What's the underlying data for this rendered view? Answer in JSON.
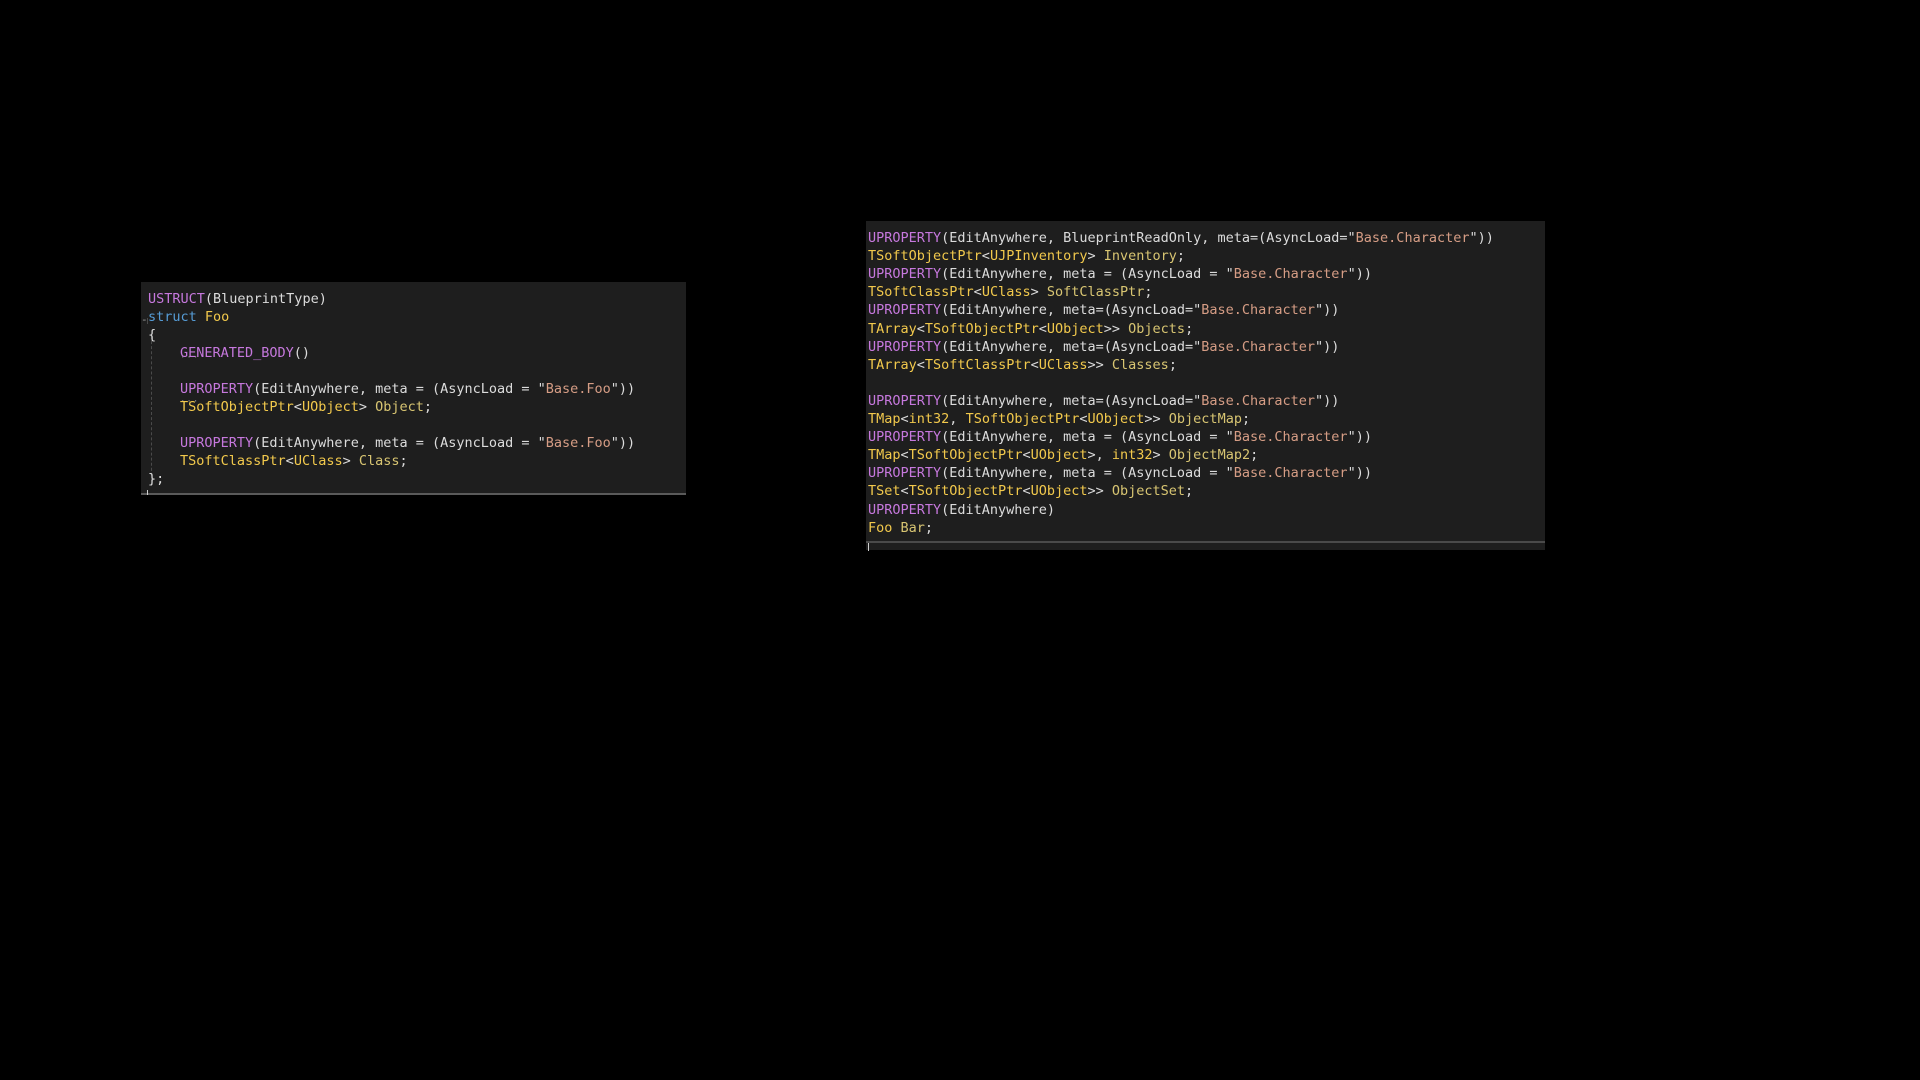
{
  "colors": {
    "background": "#000000",
    "editor_bg": "#1e1e1e",
    "plain": "#dcdcdc",
    "macro": "#c678dd",
    "keyword": "#569cd6",
    "type": "#f2c94c",
    "ident": "#d8c572",
    "string": "#d69d85"
  },
  "left_editor": {
    "lines": [
      [
        [
          "USTRUCT",
          "macro"
        ],
        [
          "(BlueprintType)",
          "plain"
        ]
      ],
      [
        [
          "struct",
          "keyword"
        ],
        [
          " ",
          "plain"
        ],
        [
          "Foo",
          "type"
        ]
      ],
      [
        [
          "{",
          "plain"
        ]
      ],
      [
        [
          "",
          "indent"
        ],
        [
          "GENERATED_BODY",
          "macro"
        ],
        [
          "()",
          "plain"
        ]
      ],
      [],
      [
        [
          "",
          "indent"
        ],
        [
          "UPROPERTY",
          "macro"
        ],
        [
          "(EditAnywhere, meta = (AsyncLoad = \"",
          "plain"
        ],
        [
          "Base.Foo",
          "string"
        ],
        [
          "\"))",
          "plain"
        ]
      ],
      [
        [
          "",
          "indent"
        ],
        [
          "TSoftObjectPtr",
          "type"
        ],
        [
          "<",
          "plain"
        ],
        [
          "UObject",
          "type"
        ],
        [
          "> ",
          "plain"
        ],
        [
          "Object",
          "ident"
        ],
        [
          ";",
          "plain"
        ]
      ],
      [],
      [
        [
          "",
          "indent"
        ],
        [
          "UPROPERTY",
          "macro"
        ],
        [
          "(EditAnywhere, meta = (AsyncLoad = \"",
          "plain"
        ],
        [
          "Base.Foo",
          "string"
        ],
        [
          "\"))",
          "plain"
        ]
      ],
      [
        [
          "",
          "indent"
        ],
        [
          "TSoftClassPtr",
          "type"
        ],
        [
          "<",
          "plain"
        ],
        [
          "UClass",
          "type"
        ],
        [
          "> ",
          "plain"
        ],
        [
          "Class",
          "ident"
        ],
        [
          ";",
          "plain"
        ]
      ],
      [
        [
          "};",
          "plain"
        ]
      ]
    ]
  },
  "right_editor": {
    "lines": [
      [
        [
          "UPROPERTY",
          "macro"
        ],
        [
          "(EditAnywhere, BlueprintReadOnly, meta=(AsyncLoad=\"",
          "plain"
        ],
        [
          "Base.Character",
          "string"
        ],
        [
          "\"))",
          "plain"
        ]
      ],
      [
        [
          "TSoftObjectPtr",
          "type"
        ],
        [
          "<",
          "plain"
        ],
        [
          "UJPInventory",
          "type"
        ],
        [
          "> ",
          "plain"
        ],
        [
          "Inventory",
          "ident"
        ],
        [
          ";",
          "plain"
        ]
      ],
      [
        [
          "UPROPERTY",
          "macro"
        ],
        [
          "(EditAnywhere, meta = (AsyncLoad = \"",
          "plain"
        ],
        [
          "Base.Character",
          "string"
        ],
        [
          "\"))",
          "plain"
        ]
      ],
      [
        [
          "TSoftClassPtr",
          "type"
        ],
        [
          "<",
          "plain"
        ],
        [
          "UClass",
          "type"
        ],
        [
          "> ",
          "plain"
        ],
        [
          "SoftClassPtr",
          "ident"
        ],
        [
          ";",
          "plain"
        ]
      ],
      [
        [
          "UPROPERTY",
          "macro"
        ],
        [
          "(EditAnywhere, meta=(AsyncLoad=\"",
          "plain"
        ],
        [
          "Base.Character",
          "string"
        ],
        [
          "\"))",
          "plain"
        ]
      ],
      [
        [
          "TArray",
          "type"
        ],
        [
          "<",
          "plain"
        ],
        [
          "TSoftObjectPtr",
          "type"
        ],
        [
          "<",
          "plain"
        ],
        [
          "UObject",
          "type"
        ],
        [
          ">> ",
          "plain"
        ],
        [
          "Objects",
          "ident"
        ],
        [
          ";",
          "plain"
        ]
      ],
      [
        [
          "UPROPERTY",
          "macro"
        ],
        [
          "(EditAnywhere, meta=(AsyncLoad=\"",
          "plain"
        ],
        [
          "Base.Character",
          "string"
        ],
        [
          "\"))",
          "plain"
        ]
      ],
      [
        [
          "TArray",
          "type"
        ],
        [
          "<",
          "plain"
        ],
        [
          "TSoftClassPtr",
          "type"
        ],
        [
          "<",
          "plain"
        ],
        [
          "UClass",
          "type"
        ],
        [
          ">> ",
          "plain"
        ],
        [
          "Classes",
          "ident"
        ],
        [
          ";",
          "plain"
        ]
      ],
      [],
      [
        [
          "UPROPERTY",
          "macro"
        ],
        [
          "(EditAnywhere, meta=(AsyncLoad=\"",
          "plain"
        ],
        [
          "Base.Character",
          "string"
        ],
        [
          "\"))",
          "plain"
        ]
      ],
      [
        [
          "TMap",
          "type"
        ],
        [
          "<",
          "plain"
        ],
        [
          "int32",
          "type"
        ],
        [
          ", ",
          "plain"
        ],
        [
          "TSoftObjectPtr",
          "type"
        ],
        [
          "<",
          "plain"
        ],
        [
          "UObject",
          "type"
        ],
        [
          ">> ",
          "plain"
        ],
        [
          "ObjectMap",
          "ident"
        ],
        [
          ";",
          "plain"
        ]
      ],
      [
        [
          "UPROPERTY",
          "macro"
        ],
        [
          "(EditAnywhere, meta = (AsyncLoad = \"",
          "plain"
        ],
        [
          "Base.Character",
          "string"
        ],
        [
          "\"))",
          "plain"
        ]
      ],
      [
        [
          "TMap",
          "type"
        ],
        [
          "<",
          "plain"
        ],
        [
          "TSoftObjectPtr",
          "type"
        ],
        [
          "<",
          "plain"
        ],
        [
          "UObject",
          "type"
        ],
        [
          ">, ",
          "plain"
        ],
        [
          "int32",
          "type"
        ],
        [
          "> ",
          "plain"
        ],
        [
          "ObjectMap2",
          "ident"
        ],
        [
          ";",
          "plain"
        ]
      ],
      [
        [
          "UPROPERTY",
          "macro"
        ],
        [
          "(EditAnywhere, meta = (AsyncLoad = \"",
          "plain"
        ],
        [
          "Base.Character",
          "string"
        ],
        [
          "\"))",
          "plain"
        ]
      ],
      [
        [
          "TSet",
          "type"
        ],
        [
          "<",
          "plain"
        ],
        [
          "TSoftObjectPtr",
          "type"
        ],
        [
          "<",
          "plain"
        ],
        [
          "UObject",
          "type"
        ],
        [
          ">> ",
          "plain"
        ],
        [
          "ObjectSet",
          "ident"
        ],
        [
          ";",
          "plain"
        ]
      ],
      [
        [
          "UPROPERTY",
          "macro"
        ],
        [
          "(EditAnywhere)",
          "plain"
        ]
      ],
      [
        [
          "Foo",
          "type"
        ],
        [
          " ",
          "plain"
        ],
        [
          "Bar",
          "ident"
        ],
        [
          ";",
          "plain"
        ]
      ]
    ]
  }
}
